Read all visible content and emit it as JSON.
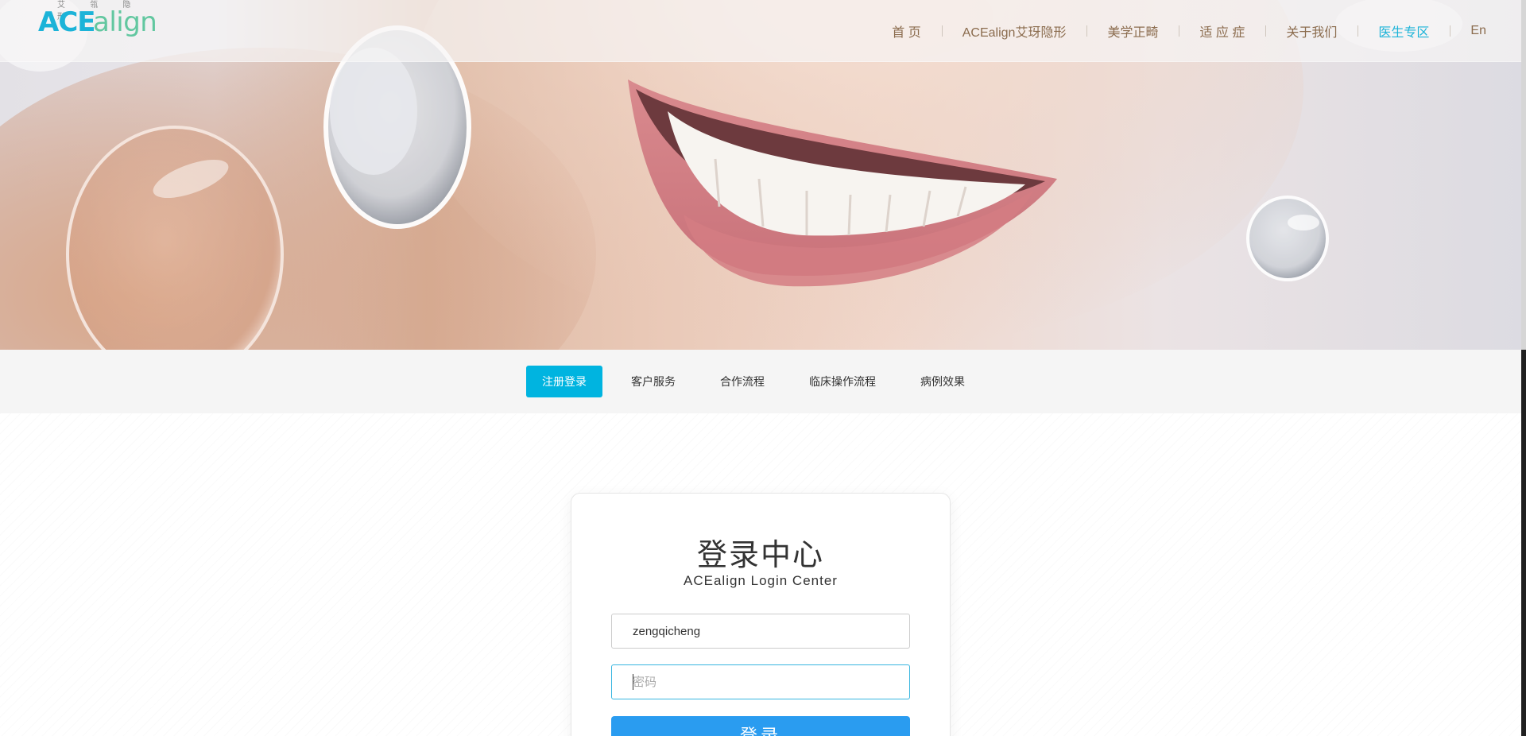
{
  "brand": {
    "logo_top_text": "艾 瓴 隐 形",
    "logo_ace": "ACE",
    "logo_align": "align",
    "accent_color": "#1cb3d8",
    "align_color": "#62c7a0"
  },
  "nav": {
    "items": [
      {
        "label": "首 页",
        "active": false
      },
      {
        "label": "ACEalign艾玡隐形",
        "active": false
      },
      {
        "label": "美学正畸",
        "active": false
      },
      {
        "label": "适 应 症",
        "active": false
      },
      {
        "label": "关于我们",
        "active": false
      },
      {
        "label": "医生专区",
        "active": true
      },
      {
        "label": "En",
        "active": false
      }
    ],
    "text_color": "#8b6c4e",
    "active_color": "#1cb3d8"
  },
  "subnav": {
    "items": [
      {
        "label": "注册登录",
        "active": true
      },
      {
        "label": "客户服务",
        "active": false
      },
      {
        "label": "合作流程",
        "active": false
      },
      {
        "label": "临床操作流程",
        "active": false
      },
      {
        "label": "病例效果",
        "active": false
      }
    ],
    "active_color": "#00b4e0"
  },
  "login": {
    "title": "登录中心",
    "subtitle": "ACEalign Login Center",
    "username_value": "zengqicheng",
    "password_value": "",
    "password_placeholder": "密码",
    "submit_label": "登录",
    "button_color": "#2a9cf0"
  }
}
